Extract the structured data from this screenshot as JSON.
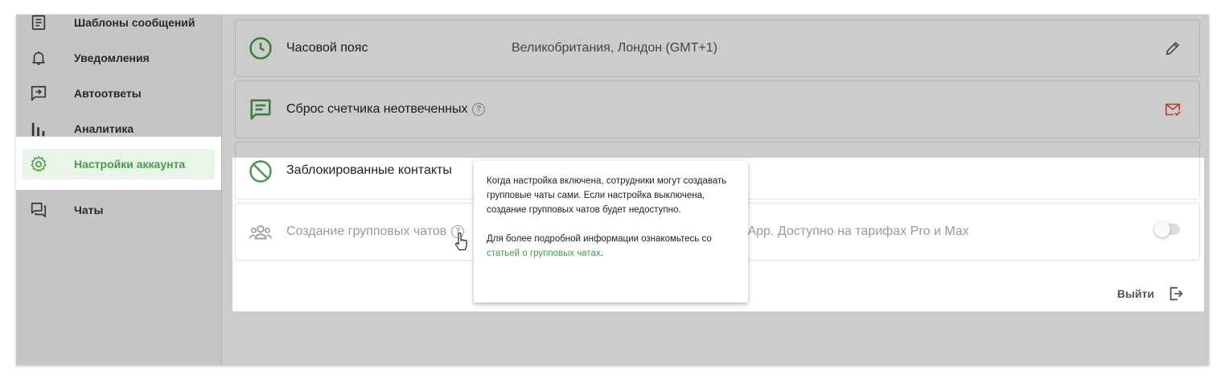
{
  "sidebar": {
    "items": [
      {
        "label": "Шаблоны сообщений",
        "icon": "document-list-icon"
      },
      {
        "label": "Уведомления",
        "icon": "bell-icon"
      },
      {
        "label": "Автоответы",
        "icon": "autoreply-icon"
      },
      {
        "label": "Аналитика",
        "icon": "bar-chart-icon"
      },
      {
        "label": "Настройки аккаунта",
        "icon": "gear-icon",
        "active": true
      },
      {
        "label": "Чаты",
        "icon": "chat-bubbles-icon"
      }
    ]
  },
  "settings": {
    "timezone": {
      "title": "Часовой пояс",
      "value": "Великобритания, Лондон (GMT+1)"
    },
    "unanswered": {
      "title": "Сброс счетчика неотвеченных"
    },
    "blocked": {
      "title": "Заблокированные контакты"
    },
    "group_chats": {
      "title": "Создание групповых чатов",
      "value_visible": "tsApp. Доступно на тарифах Pro и Max",
      "enabled": false
    }
  },
  "logout": {
    "label": "Выйти"
  },
  "tooltip": {
    "paragraph1": "Когда настройка включена, сотрудники могут создавать групповые чаты сами. Если настройка выключена, создание групповых чатов будет недоступно.",
    "paragraph2_prefix": "Для более подробной информации ознакомьтесь со ",
    "paragraph2_link": "статьей о групповых чатах",
    "paragraph2_suffix": "."
  },
  "colors": {
    "accent": "#43a047",
    "warning": "#e2582b",
    "overlay": "rgba(0,0,0,0.2)"
  }
}
